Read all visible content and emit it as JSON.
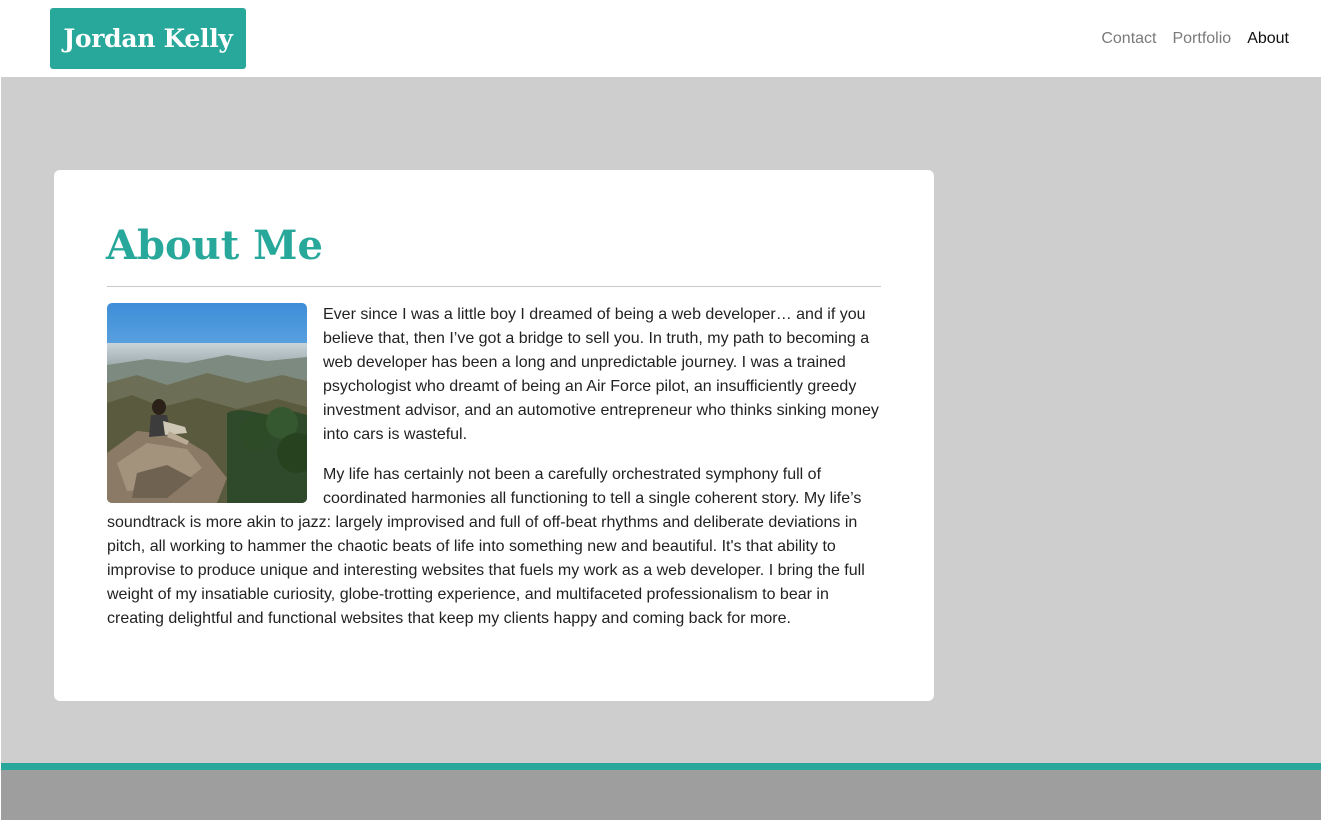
{
  "navbar": {
    "brand": "Jordan Kelly",
    "links": [
      {
        "label": "Contact",
        "active": false
      },
      {
        "label": "Portfolio",
        "active": false
      },
      {
        "label": "About",
        "active": true
      }
    ]
  },
  "about": {
    "title": "About Me",
    "paragraphs": [
      "Ever since I was a little boy I dreamed of being a web developer… and if you believe that, then I’ve got a bridge to sell you. In truth, my path to becoming a web developer has been a long and unpredictable journey. I was a trained psychologist who dreamt of being an Air Force pilot, an insufficiently greedy investment advisor, and an automotive entrepreneur who thinks sinking money into cars is wasteful.",
      "My life has certainly not been a carefully orchestrated symphony full of coordinated harmonies all functioning to tell a single coherent story. My life’s soundtrack is more akin to jazz: largely improvised and full of off-beat rhythms and deliberate deviations in pitch, all working to hammer the chaotic beats of life into something new and beautiful. It's that ability to improvise to produce unique and interesting websites that fuels my work as a web developer. I bring the full weight of my insatiable curiosity, globe-trotting experience, and multifaceted professionalism to bear in creating delightful and functional websites that keep my clients happy and coming back for more."
    ]
  },
  "colors": {
    "accent": "#27a89a",
    "main_bg": "#cecece",
    "footer_bg": "#9e9e9e"
  }
}
